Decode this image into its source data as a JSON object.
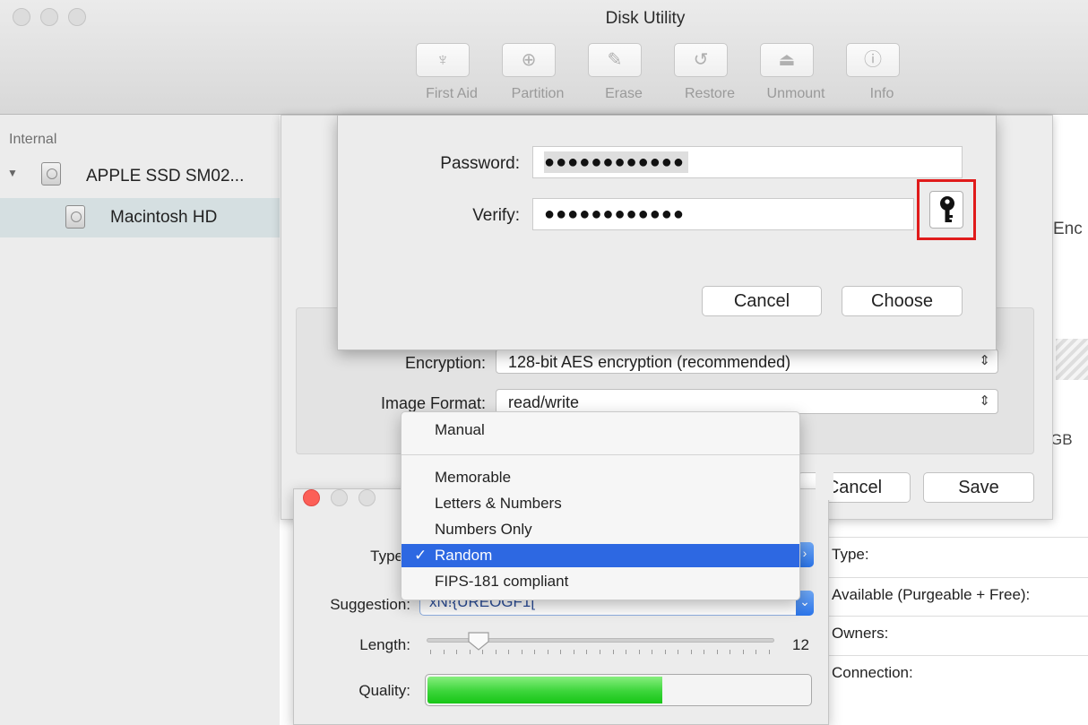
{
  "window": {
    "title": "Disk Utility"
  },
  "toolbar": {
    "items": [
      {
        "label": "First Aid",
        "icon": "stethoscope-icon"
      },
      {
        "label": "Partition",
        "icon": "partition-pie-icon"
      },
      {
        "label": "Erase",
        "icon": "erase-icon"
      },
      {
        "label": "Restore",
        "icon": "restore-icon"
      },
      {
        "label": "Unmount",
        "icon": "eject-icon"
      },
      {
        "label": "Info",
        "icon": "info-icon"
      }
    ]
  },
  "sidebar": {
    "section": "Internal",
    "disk": "APPLE SSD SM02...",
    "volume": "Macintosh HD"
  },
  "main": {
    "partial_heading": "Enc",
    "partial_capacity": "GB",
    "info_labels": [
      "Type:",
      "Available (Purgeable + Free):",
      "Owners:",
      "Connection:"
    ]
  },
  "new_image_sheet": {
    "encryption_label": "Encryption:",
    "encryption_value": "128-bit AES encryption (recommended)",
    "format_label": "Image Format:",
    "format_value": "read/write",
    "cancel_label": "Cancel",
    "save_label": "Save"
  },
  "password_sheet": {
    "password_label": "Password:",
    "password_masked": "●●●●●●●●●●●●",
    "verify_label": "Verify:",
    "verify_masked": "●●●●●●●●●●●●",
    "cancel_label": "Cancel",
    "choose_label": "Choose",
    "key_icon": "key-icon"
  },
  "assistant": {
    "type_label": "Type",
    "suggestion_label": "Suggestion:",
    "suggestion_value": "xN!{UREOGF1[",
    "length_label": "Length:",
    "length_value": "12",
    "length_fraction": 0.15,
    "quality_label": "Quality:",
    "quality_fraction": 0.61,
    "quality_color": "#17c616"
  },
  "type_menu": {
    "selected": "Random",
    "items": [
      "Manual",
      "Memorable",
      "Letters & Numbers",
      "Numbers Only",
      "Random",
      "FIPS-181 compliant"
    ],
    "check_glyph": "✓"
  }
}
